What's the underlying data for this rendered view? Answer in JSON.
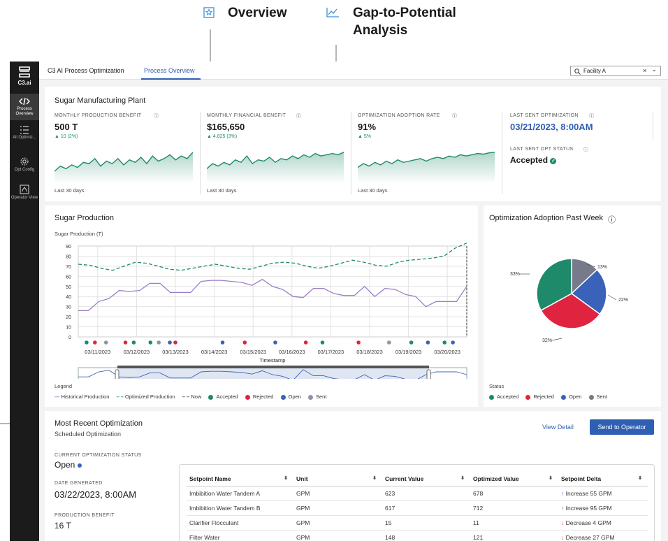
{
  "annotations": {
    "overview": "Overview",
    "gap1": "Gap-to-Potential",
    "gap2": "Analysis"
  },
  "logo": "C3.ai",
  "sidebar": {
    "items": [
      {
        "label": "Process Overview",
        "icon": "code-icon"
      },
      {
        "label": "All Optimiz...",
        "icon": "list-icon"
      },
      {
        "label": "Opt Config",
        "icon": "gear-icon"
      },
      {
        "label": "Operator View",
        "icon": "operator-icon"
      }
    ]
  },
  "topbar": {
    "app_name": "C3 AI Process Optimization",
    "tab": "Process Overview",
    "search_value": "Facility A"
  },
  "plant": {
    "title": "Sugar Manufacturing Plant",
    "kpis": [
      {
        "label": "MONTHLY PRODUCTION BENEFIT",
        "value": "500 T",
        "delta": "10 (2%)",
        "footer": "Last 30 days"
      },
      {
        "label": "MONTHLY FINANCIAL BENEFIT",
        "value": "$165,650",
        "delta": "4,825 (3%)",
        "footer": "Last 30 days"
      },
      {
        "label": "OPTIMIZATION ADOPTION RATE",
        "value": "91%",
        "delta": "5%",
        "footer": "Last 30 days"
      }
    ],
    "last_sent_label": "LAST SENT OPTIMIZATION",
    "last_sent_value": "03/21/2023, 8:00AM",
    "status_label": "LAST SENT OPT STATUS",
    "status_value": "Accepted"
  },
  "production": {
    "title": "Sugar Production",
    "subtitle": "Sugar Production (T)",
    "xlabel": "Timestamp",
    "legend_title": "Legend",
    "legend": [
      "Historical Production",
      "Optimized Production",
      "Now",
      "Accepted",
      "Rejected",
      "Open",
      "Sent"
    ]
  },
  "adoption": {
    "title": "Optimization Adoption Past Week",
    "status_label": "Status",
    "legend": [
      "Accepted",
      "Rejected",
      "Open",
      "Sent"
    ]
  },
  "recent": {
    "title": "Most Recent Optimization",
    "subtitle": "Scheduled Optimization",
    "view_detail": "View Detail",
    "send": "Send to Operator",
    "status_label": "CURRENT OPTIMIZATION STATUS",
    "status_value": "Open",
    "date_label": "DATE GENERATED",
    "date_value": "03/22/2023, 8:00AM",
    "benefit_label": "PRODUCTION BENEFIT",
    "benefit_value": "16 T",
    "columns": [
      "Setpoint Name",
      "Unit",
      "Current Value",
      "Optimized Value",
      "Setpoint Delta"
    ],
    "rows": [
      [
        "Imbibition Water Tandem A",
        "GPM",
        "623",
        "678",
        "Increase 55 GPM"
      ],
      [
        "Imbibition Water Tandem B",
        "GPM",
        "617",
        "712",
        "Increase 95 GPM"
      ],
      [
        "Clarifier Flocculant",
        "GPM",
        "15",
        "11",
        "Decrease 4 GPM"
      ],
      [
        "Filter Water",
        "GPM",
        "148",
        "121",
        "Decrease 27 GPM"
      ]
    ]
  },
  "colors": {
    "accent": "#2f5fb3",
    "accepted": "#1f8a6a",
    "rejected": "#e0243f",
    "open": "#3a62b8",
    "sent": "#777a8a",
    "historical": "#9b7fc4",
    "optimized": "#1f8a6a"
  },
  "chart_data": [
    {
      "type": "line",
      "title": "Sugar Production",
      "ylabel": "Sugar Production (T)",
      "xlabel": "Timestamp",
      "ylim": [
        0,
        90
      ],
      "yticks": [
        "0",
        "10",
        "20",
        "30",
        "40",
        "50",
        "60",
        "70",
        "80",
        "90"
      ],
      "categories": [
        "03/11/2023",
        "03/12/2023",
        "03/13/2023",
        "03/14/2023",
        "03/15/2023",
        "03/16/2023",
        "03/17/2023",
        "03/18/2023",
        "03/19/2023",
        "03/20/2023"
      ],
      "series": [
        {
          "name": "Historical Production",
          "values": [
            26,
            26,
            35,
            38,
            46,
            45,
            46,
            53,
            53,
            44,
            44,
            44,
            55,
            56,
            56,
            55,
            54,
            51,
            57,
            50,
            47,
            40,
            39,
            48,
            48,
            43,
            41,
            41,
            50,
            40,
            48,
            47,
            42,
            40,
            30,
            35,
            35,
            35,
            50
          ]
        },
        {
          "name": "Optimized Production",
          "values": [
            72,
            71,
            68,
            66,
            70,
            74,
            73,
            70,
            67,
            66,
            68,
            70,
            72,
            70,
            68,
            67,
            70,
            73,
            74,
            73,
            70,
            68,
            70,
            73,
            76,
            74,
            71,
            70,
            74,
            76,
            77,
            78,
            80,
            88,
            93
          ]
        }
      ],
      "events": [
        {
          "x": 0.3,
          "s": "Accepted"
        },
        {
          "x": 0.6,
          "s": "Rejected"
        },
        {
          "x": 1.0,
          "s": "Sent"
        },
        {
          "x": 1.7,
          "s": "Rejected"
        },
        {
          "x": 2.0,
          "s": "Accepted"
        },
        {
          "x": 2.6,
          "s": "Accepted"
        },
        {
          "x": 2.9,
          "s": "Sent"
        },
        {
          "x": 3.3,
          "s": "Open"
        },
        {
          "x": 3.5,
          "s": "Rejected"
        },
        {
          "x": 5.2,
          "s": "Open"
        },
        {
          "x": 6.0,
          "s": "Rejected"
        },
        {
          "x": 7.1,
          "s": "Open"
        },
        {
          "x": 8.2,
          "s": "Rejected"
        },
        {
          "x": 8.8,
          "s": "Accepted"
        },
        {
          "x": 10.1,
          "s": "Rejected"
        },
        {
          "x": 11.2,
          "s": "Sent"
        },
        {
          "x": 12.0,
          "s": "Accepted"
        },
        {
          "x": 12.6,
          "s": "Open"
        },
        {
          "x": 13.2,
          "s": "Accepted"
        },
        {
          "x": 13.5,
          "s": "Open"
        }
      ]
    },
    {
      "type": "pie",
      "title": "Optimization Adoption Past Week",
      "slices": [
        {
          "label": "Accepted",
          "value": 33
        },
        {
          "label": "Rejected",
          "value": 32
        },
        {
          "label": "Open",
          "value": 22
        },
        {
          "label": "Sent",
          "value": 13
        }
      ],
      "labels": [
        "13%",
        "22%",
        "32%",
        "33%"
      ]
    },
    {
      "type": "area",
      "title": "MONTHLY PRODUCTION BENEFIT",
      "values": [
        10,
        18,
        14,
        20,
        16,
        24,
        22,
        30,
        18,
        26,
        22,
        30,
        20,
        28,
        24,
        32,
        22,
        34,
        26,
        30,
        36,
        28,
        34,
        30,
        40
      ]
    },
    {
      "type": "area",
      "title": "MONTHLY FINANCIAL BENEFIT",
      "values": [
        14,
        22,
        18,
        24,
        20,
        28,
        24,
        34,
        22,
        28,
        26,
        32,
        24,
        30,
        28,
        34,
        30,
        36,
        32,
        38,
        34,
        36,
        38,
        36,
        40
      ]
    },
    {
      "type": "area",
      "title": "OPTIMIZATION ADOPTION RATE",
      "values": [
        16,
        22,
        18,
        24,
        20,
        26,
        22,
        28,
        24,
        26,
        28,
        30,
        26,
        30,
        32,
        30,
        34,
        32,
        36,
        34,
        36,
        38,
        37,
        39,
        40
      ]
    }
  ]
}
